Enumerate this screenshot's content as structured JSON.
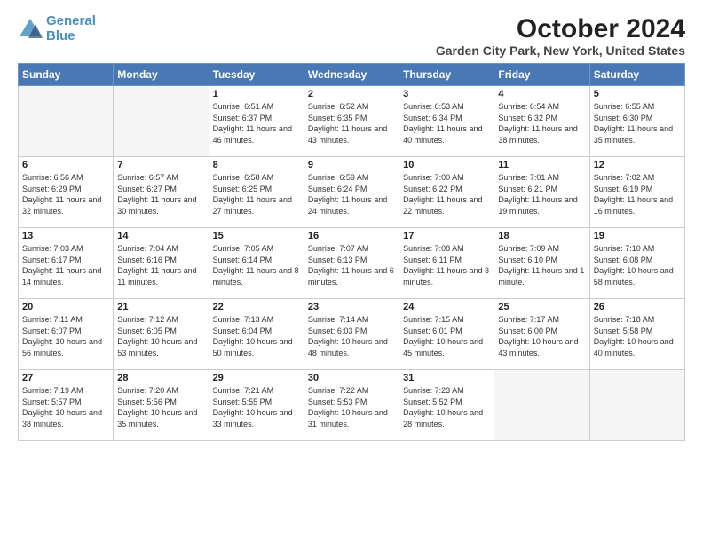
{
  "logo": {
    "line1": "General",
    "line2": "Blue"
  },
  "title": "October 2024",
  "subtitle": "Garden City Park, New York, United States",
  "headers": [
    "Sunday",
    "Monday",
    "Tuesday",
    "Wednesday",
    "Thursday",
    "Friday",
    "Saturday"
  ],
  "weeks": [
    [
      {
        "day": "",
        "info": ""
      },
      {
        "day": "",
        "info": ""
      },
      {
        "day": "1",
        "info": "Sunrise: 6:51 AM\nSunset: 6:37 PM\nDaylight: 11 hours and 46 minutes."
      },
      {
        "day": "2",
        "info": "Sunrise: 6:52 AM\nSunset: 6:35 PM\nDaylight: 11 hours and 43 minutes."
      },
      {
        "day": "3",
        "info": "Sunrise: 6:53 AM\nSunset: 6:34 PM\nDaylight: 11 hours and 40 minutes."
      },
      {
        "day": "4",
        "info": "Sunrise: 6:54 AM\nSunset: 6:32 PM\nDaylight: 11 hours and 38 minutes."
      },
      {
        "day": "5",
        "info": "Sunrise: 6:55 AM\nSunset: 6:30 PM\nDaylight: 11 hours and 35 minutes."
      }
    ],
    [
      {
        "day": "6",
        "info": "Sunrise: 6:56 AM\nSunset: 6:29 PM\nDaylight: 11 hours and 32 minutes."
      },
      {
        "day": "7",
        "info": "Sunrise: 6:57 AM\nSunset: 6:27 PM\nDaylight: 11 hours and 30 minutes."
      },
      {
        "day": "8",
        "info": "Sunrise: 6:58 AM\nSunset: 6:25 PM\nDaylight: 11 hours and 27 minutes."
      },
      {
        "day": "9",
        "info": "Sunrise: 6:59 AM\nSunset: 6:24 PM\nDaylight: 11 hours and 24 minutes."
      },
      {
        "day": "10",
        "info": "Sunrise: 7:00 AM\nSunset: 6:22 PM\nDaylight: 11 hours and 22 minutes."
      },
      {
        "day": "11",
        "info": "Sunrise: 7:01 AM\nSunset: 6:21 PM\nDaylight: 11 hours and 19 minutes."
      },
      {
        "day": "12",
        "info": "Sunrise: 7:02 AM\nSunset: 6:19 PM\nDaylight: 11 hours and 16 minutes."
      }
    ],
    [
      {
        "day": "13",
        "info": "Sunrise: 7:03 AM\nSunset: 6:17 PM\nDaylight: 11 hours and 14 minutes."
      },
      {
        "day": "14",
        "info": "Sunrise: 7:04 AM\nSunset: 6:16 PM\nDaylight: 11 hours and 11 minutes."
      },
      {
        "day": "15",
        "info": "Sunrise: 7:05 AM\nSunset: 6:14 PM\nDaylight: 11 hours and 8 minutes."
      },
      {
        "day": "16",
        "info": "Sunrise: 7:07 AM\nSunset: 6:13 PM\nDaylight: 11 hours and 6 minutes."
      },
      {
        "day": "17",
        "info": "Sunrise: 7:08 AM\nSunset: 6:11 PM\nDaylight: 11 hours and 3 minutes."
      },
      {
        "day": "18",
        "info": "Sunrise: 7:09 AM\nSunset: 6:10 PM\nDaylight: 11 hours and 1 minute."
      },
      {
        "day": "19",
        "info": "Sunrise: 7:10 AM\nSunset: 6:08 PM\nDaylight: 10 hours and 58 minutes."
      }
    ],
    [
      {
        "day": "20",
        "info": "Sunrise: 7:11 AM\nSunset: 6:07 PM\nDaylight: 10 hours and 56 minutes."
      },
      {
        "day": "21",
        "info": "Sunrise: 7:12 AM\nSunset: 6:05 PM\nDaylight: 10 hours and 53 minutes."
      },
      {
        "day": "22",
        "info": "Sunrise: 7:13 AM\nSunset: 6:04 PM\nDaylight: 10 hours and 50 minutes."
      },
      {
        "day": "23",
        "info": "Sunrise: 7:14 AM\nSunset: 6:03 PM\nDaylight: 10 hours and 48 minutes."
      },
      {
        "day": "24",
        "info": "Sunrise: 7:15 AM\nSunset: 6:01 PM\nDaylight: 10 hours and 45 minutes."
      },
      {
        "day": "25",
        "info": "Sunrise: 7:17 AM\nSunset: 6:00 PM\nDaylight: 10 hours and 43 minutes."
      },
      {
        "day": "26",
        "info": "Sunrise: 7:18 AM\nSunset: 5:58 PM\nDaylight: 10 hours and 40 minutes."
      }
    ],
    [
      {
        "day": "27",
        "info": "Sunrise: 7:19 AM\nSunset: 5:57 PM\nDaylight: 10 hours and 38 minutes."
      },
      {
        "day": "28",
        "info": "Sunrise: 7:20 AM\nSunset: 5:56 PM\nDaylight: 10 hours and 35 minutes."
      },
      {
        "day": "29",
        "info": "Sunrise: 7:21 AM\nSunset: 5:55 PM\nDaylight: 10 hours and 33 minutes."
      },
      {
        "day": "30",
        "info": "Sunrise: 7:22 AM\nSunset: 5:53 PM\nDaylight: 10 hours and 31 minutes."
      },
      {
        "day": "31",
        "info": "Sunrise: 7:23 AM\nSunset: 5:52 PM\nDaylight: 10 hours and 28 minutes."
      },
      {
        "day": "",
        "info": ""
      },
      {
        "day": "",
        "info": ""
      }
    ]
  ]
}
